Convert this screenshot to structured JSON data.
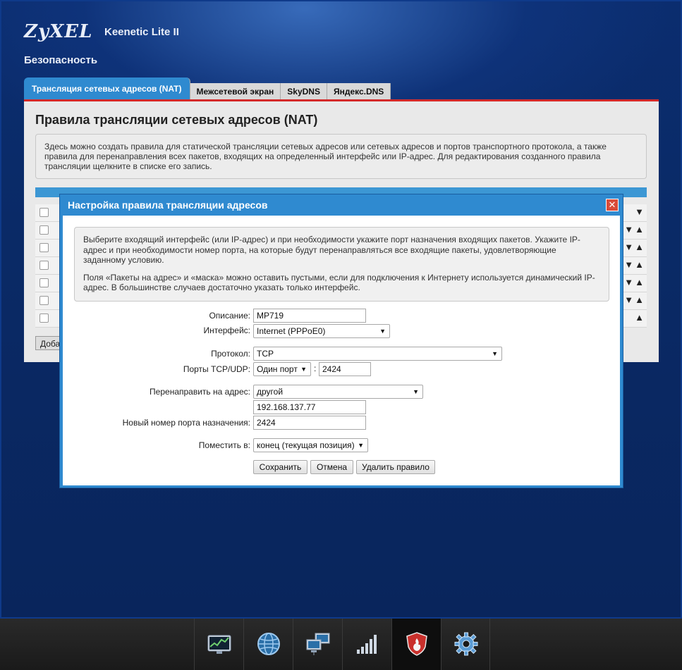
{
  "header": {
    "brand": "ZyXEL",
    "model": "Keenetic Lite II",
    "section": "Безопасность"
  },
  "tabs": [
    {
      "label": "Трансляция сетевых адресов (NAT)",
      "active": true
    },
    {
      "label": "Межсетевой экран",
      "active": false
    },
    {
      "label": "SkyDNS",
      "active": false
    },
    {
      "label": "Яндекс.DNS",
      "active": false
    }
  ],
  "panel": {
    "title": "Правила трансляции сетевых адресов (NAT)",
    "info": "Здесь можно создать правила для статической трансляции сетевых адресов или сетевых адресов и портов транспортного протокола, а также правила для перенаправления всех пакетов, входящих на определенный интерфейс или IP-адрес. Для редактирования созданного правила трансляции щелкните в списке его запись.",
    "add_button": "Добавить"
  },
  "modal": {
    "title": "Настройка правила трансляции адресов",
    "close": "✕",
    "hint_p1": "Выберите входящий интерфейс (или IP-адрес) и при необходимости укажите порт назначения входящих пакетов. Укажите IP-адрес и при необходимости номер порта, на которые будут перенаправляться все входящие пакеты, удовлетворяющие заданному условию.",
    "hint_p2": "Поля «Пакеты на адрес» и «маска» можно оставить пустыми, если для подключения к Интернету используется динамический IP-адрес. В большинстве случаев достаточно указать только интерфейс.",
    "form": {
      "description_label": "Описание:",
      "description_value": "MP719",
      "interface_label": "Интерфейс:",
      "interface_value": "Internet (PPPoE0)",
      "protocol_label": "Протокол:",
      "protocol_value": "TCP",
      "ports_label": "Порты TCP/UDP:",
      "ports_mode": "Один порт",
      "ports_colon": ":",
      "ports_value": "2424",
      "redirect_label": "Перенаправить на адрес:",
      "redirect_mode": "другой",
      "redirect_ip": "192.168.137.77",
      "newport_label": "Новый номер порта назначения:",
      "newport_value": "2424",
      "place_label": "Поместить в:",
      "place_value": "конец (текущая позиция)"
    },
    "buttons": {
      "save": "Сохранить",
      "cancel": "Отмена",
      "delete": "Удалить правило"
    }
  },
  "dock": [
    {
      "icon": "monitor-chart-icon"
    },
    {
      "icon": "globe-icon"
    },
    {
      "icon": "network-computers-icon"
    },
    {
      "icon": "signal-bars-icon"
    },
    {
      "icon": "security-shield-icon",
      "active": true
    },
    {
      "icon": "gear-icon"
    }
  ],
  "colors": {
    "accent": "#2f8ad0",
    "tab_border": "#d42a2a",
    "background": "#0a2a66"
  }
}
